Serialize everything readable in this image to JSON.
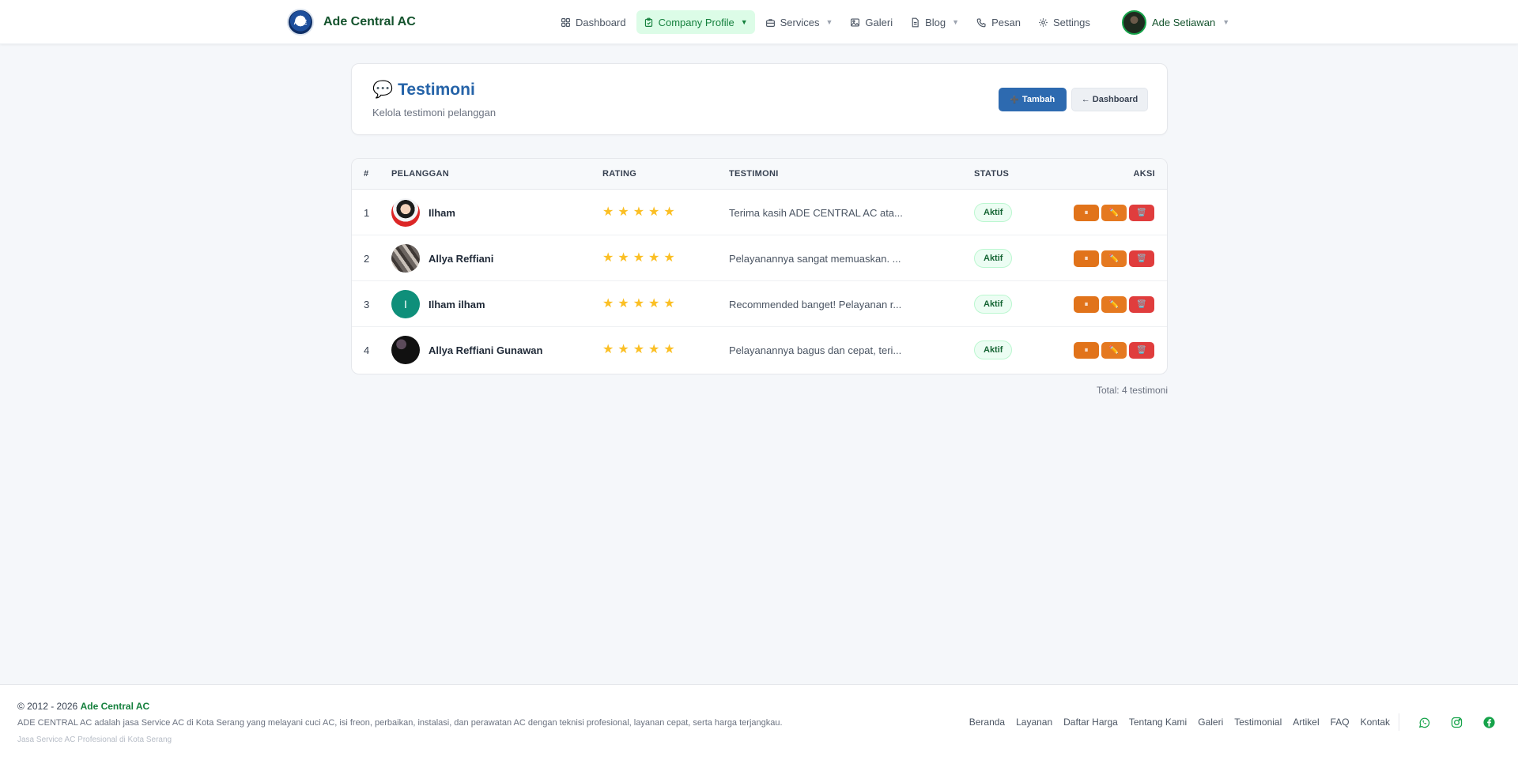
{
  "brand": {
    "name": "Ade Central AC"
  },
  "nav": {
    "items": [
      {
        "label": "Dashboard",
        "icon": "grid-icon"
      },
      {
        "label": "Company Profile",
        "icon": "clipboard-icon",
        "active": true,
        "dropdown": true
      },
      {
        "label": "Services",
        "icon": "briefcase-icon",
        "dropdown": true
      },
      {
        "label": "Galeri",
        "icon": "image-icon"
      },
      {
        "label": "Blog",
        "icon": "document-icon",
        "dropdown": true
      },
      {
        "label": "Pesan",
        "icon": "phone-icon"
      },
      {
        "label": "Settings",
        "icon": "settings-icon"
      }
    ]
  },
  "user": {
    "name": "Ade Setiawan"
  },
  "header": {
    "icon": "💬",
    "title": "Testimoni",
    "subtitle": "Kelola testimoni pelanggan",
    "add_label": "Tambah",
    "add_icon": "➕",
    "back_label": "← Dashboard"
  },
  "table": {
    "columns": [
      "#",
      "Pelanggan",
      "Rating",
      "Testimoni",
      "Status",
      "Aksi"
    ],
    "rows": [
      {
        "num": "1",
        "name": "Ilham",
        "initial": "",
        "rating": 5,
        "text": "Terima kasih ADE CENTRAL AC ata...",
        "status": "Aktif"
      },
      {
        "num": "2",
        "name": "Allya Reffiani",
        "initial": "",
        "rating": 5,
        "text": "Pelayanannya sangat memuaskan. ...",
        "status": "Aktif"
      },
      {
        "num": "3",
        "name": "Ilham ilham",
        "initial": "I",
        "rating": 5,
        "text": "Recommended banget! Pelayanan r...",
        "status": "Aktif"
      },
      {
        "num": "4",
        "name": "Allya Reffiani Gunawan",
        "initial": "",
        "rating": 5,
        "text": "Pelayanannya bagus dan cepat, teri...",
        "status": "Aktif"
      }
    ],
    "actions": {
      "pause": "⏸",
      "edit": "✏️",
      "delete": "🗑️"
    }
  },
  "total": "Total: 4 testimoni",
  "footer": {
    "copyright_prefix": "© 2012 - 2026 ",
    "copyright_brand": "Ade Central AC",
    "description": "ADE CENTRAL AC adalah jasa Service AC di Kota Serang yang melayani cuci AC, isi freon, perbaikan, instalasi, dan perawatan AC dengan teknisi profesional, layanan cepat, serta harga terjangkau.",
    "tagline": "Jasa Service AC Profesional di Kota Serang",
    "links": [
      "Beranda",
      "Layanan",
      "Daftar Harga",
      "Tentang Kami",
      "Galeri",
      "Testimonial",
      "Artikel",
      "FAQ",
      "Kontak"
    ],
    "social": [
      "whatsapp-icon",
      "instagram-icon",
      "facebook-icon"
    ],
    "social_color": "#16a34a"
  }
}
